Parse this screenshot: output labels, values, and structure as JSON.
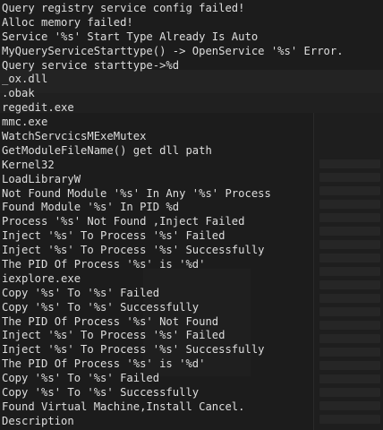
{
  "strings": [
    "Query registry service config failed!",
    "Alloc memory failed!",
    "Service '%s' Start Type Already Is Auto",
    "MyQueryServiceStarttype() -> OpenService '%s' Error.",
    "Query service starttype->%d",
    "_ox.dll",
    ".obak",
    "regedit.exe",
    "mmc.exe",
    "WatchServcicsMExeMutex",
    "GetModuleFileName() get dll path",
    "Kernel32",
    "LoadLibraryW",
    "Not Found Module '%s' In Any '%s' Process",
    "Found Module '%s' In PID %d",
    "Process '%s' Not Found ,Inject Failed",
    "Inject '%s' To Process '%s' Failed",
    "Inject '%s' To Process '%s' Successfully",
    "The PID Of Process '%s' is '%d'",
    "iexplore.exe",
    "Copy '%s' To '%s' Failed",
    "Copy '%s' To '%s' Successfully",
    "The PID Of Process '%s' Not Found",
    "Inject '%s' To Process '%s' Failed",
    "Inject '%s' To Process '%s' Successfully",
    "The PID Of Process '%s' is '%d'",
    "Copy '%s' To '%s' Failed",
    "Copy '%s' To '%s' Successfully",
    "Found Virtual Machine,Install Cancel.",
    "Description"
  ],
  "colors": {
    "text": "#dedede",
    "background": "#1a1a1a"
  }
}
